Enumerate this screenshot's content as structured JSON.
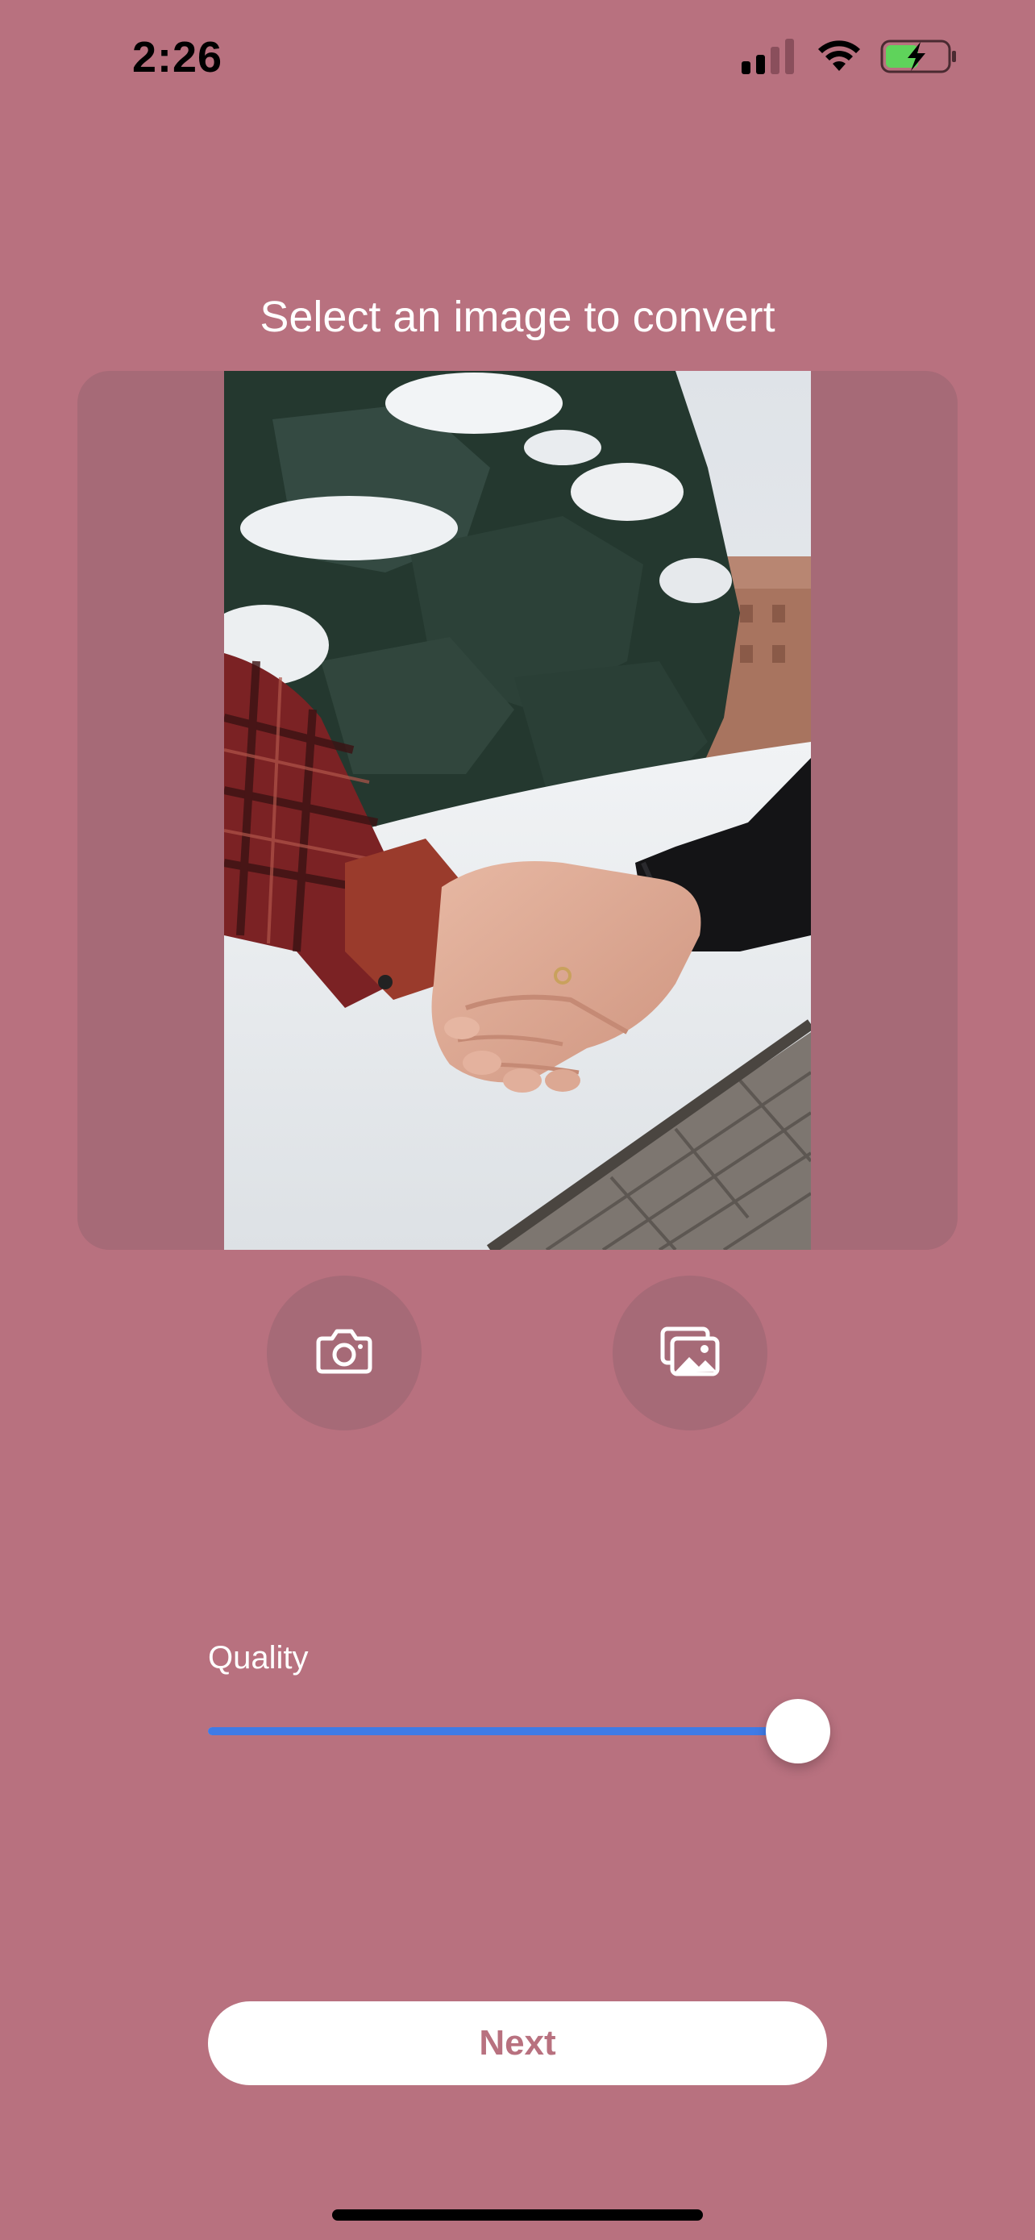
{
  "status_bar": {
    "time": "2:26"
  },
  "header": {
    "title": "Select an image to convert"
  },
  "preview": {
    "subject": "holding-hands-in-snow-photo"
  },
  "actions": {
    "camera_icon": "camera-icon",
    "gallery_icon": "photo-library-icon"
  },
  "quality": {
    "label": "Quality",
    "value": 0.95
  },
  "footer": {
    "next_label": "Next"
  },
  "colors": {
    "background": "#b8717f",
    "panel": "#a66a77",
    "accent": "#3f7be6"
  }
}
